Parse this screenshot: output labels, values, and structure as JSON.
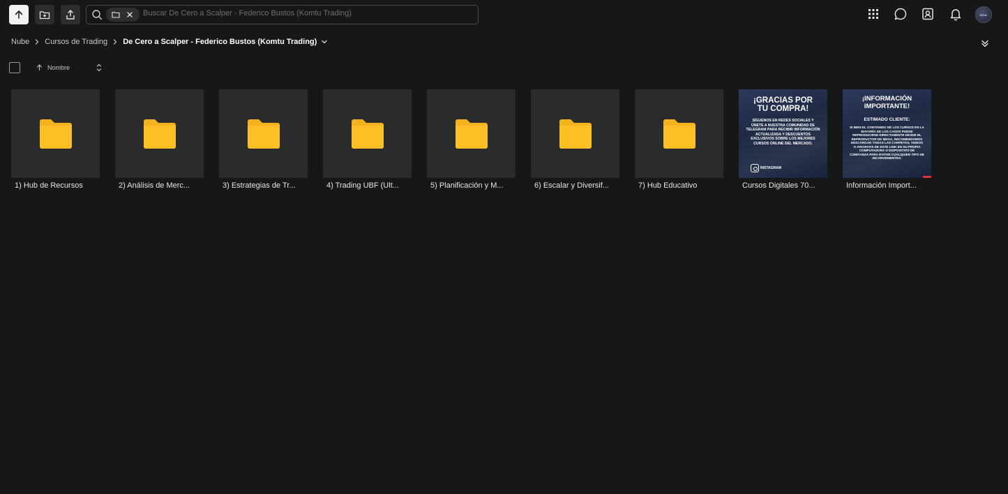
{
  "toolbar": {
    "up_button": "up-arrow-icon",
    "new_folder_button": "new-folder-icon",
    "upload_button": "upload-icon"
  },
  "search": {
    "placeholder": "Buscar De Cero a Scalper - Federico Bustos (Komtu Trading)",
    "chip_icon": "folder-icon"
  },
  "header_icons": [
    "apps-grid-icon",
    "chat-icon",
    "contacts-icon",
    "bell-icon"
  ],
  "avatar": {
    "text": "SOUL"
  },
  "breadcrumb": [
    {
      "label": "Nube"
    },
    {
      "label": "Cursos de Trading"
    },
    {
      "label": "De Cero a Scalper - Federico Bustos (Komtu Trading)"
    }
  ],
  "sort": {
    "label": "Nombre",
    "direction": "ascending"
  },
  "items": [
    {
      "label": "1) Hub de Recursos",
      "type": "folder"
    },
    {
      "label": "2) Análisis de Merc...",
      "type": "folder"
    },
    {
      "label": "3) Estrategias de Tr...",
      "type": "folder"
    },
    {
      "label": "4) Trading UBF (Ult...",
      "type": "folder"
    },
    {
      "label": "5) Planificación y M...",
      "type": "folder"
    },
    {
      "label": "6) Escalar y Diversif...",
      "type": "folder"
    },
    {
      "label": "7) Hub Educativo",
      "type": "folder"
    },
    {
      "label": "Cursos Digitales 70...",
      "type": "image"
    },
    {
      "label": "Información Import...",
      "type": "image"
    }
  ],
  "poster1": {
    "title1": "¡GRACIAS POR",
    "title2": "TU COMPRA!",
    "body": "SÍGUENOS EN REDES SOCIALES Y ÚNETE A NUESTRA COMUNIDAD DE TELEGRAM PARA RECIBIR INFORMACIÓN ACTUALIZADA Y DESCUENTOS EXCLUSIVOS SOBRE LOS MEJORES CURSOS ONLINE DEL MERCADO.",
    "social": "INSTAGRAM"
  },
  "poster2": {
    "title1": "¡INFORMACIÓN",
    "title2": "IMPORTANTE!",
    "subtitle": "ESTIMADO CLIENTE:",
    "body": "SI BIEN EL CONTENIDO DE LOS CURSOS EN LA MAYORÍA DE LOS CASOS PUEDE REPRODUCIRSE DIRECTAMENTE DESDE EL REPRODUCTOR DE MEGA, RECOMENDAMOS DESCARGAR TODAS LAS CARPETAS, VIDEOS O ARCHIVOS DE ESTE LINK EN SU PROPIA COMPUTADORA O DISPOSITIVO DE CONFIANZA PARA EVITAR CUALQUIER TIPO DE INCONVENIENTES."
  },
  "colors": {
    "background": "#161718",
    "tile": "#2a2b2d",
    "folder": "#f5b31d",
    "accent_button": "#f3f3f3"
  }
}
